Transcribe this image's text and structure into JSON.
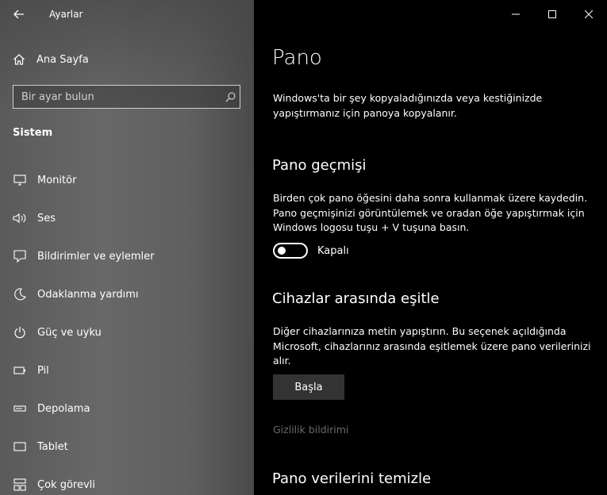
{
  "window": {
    "title": "Ayarlar"
  },
  "sidebar": {
    "home_label": "Ana Sayfa",
    "search_placeholder": "Bir ayar bulun",
    "section_title": "Sistem",
    "items": [
      {
        "label": "Monitör",
        "icon": "monitor-icon"
      },
      {
        "label": "Ses",
        "icon": "speaker-icon"
      },
      {
        "label": "Bildirimler ve eylemler",
        "icon": "notification-icon"
      },
      {
        "label": "Odaklanma yardımı",
        "icon": "moon-icon"
      },
      {
        "label": "Güç ve uyku",
        "icon": "power-icon"
      },
      {
        "label": "Pil",
        "icon": "battery-icon"
      },
      {
        "label": "Depolama",
        "icon": "storage-icon"
      },
      {
        "label": "Tablet",
        "icon": "tablet-icon"
      },
      {
        "label": "Çok görevli",
        "icon": "multitasking-icon"
      }
    ]
  },
  "main": {
    "title": "Pano",
    "intro": "Windows'ta bir şey kopyaladığınızda veya kestiğinizde yapıştırmanız için panoya kopyalanır.",
    "history": {
      "heading": "Pano geçmişi",
      "description": "Birden çok pano öğesini daha sonra kullanmak üzere kaydedin. Pano geçmişinizi görüntülemek ve oradan öğe yapıştırmak için Windows logosu tuşu + V tuşuna basın.",
      "toggle_state": "Kapalı"
    },
    "sync": {
      "heading": "Cihazlar arasında eşitle",
      "description": "Diğer cihazlarınıza metin yapıştırın. Bu seçenek açıldığında Microsoft, cihazlarınız arasında eşitlemek üzere pano verilerinizi alır.",
      "button_label": "Başla",
      "privacy_link": "Gizlilik bildirimi"
    },
    "clear": {
      "heading": "Pano verilerini temizle"
    }
  }
}
